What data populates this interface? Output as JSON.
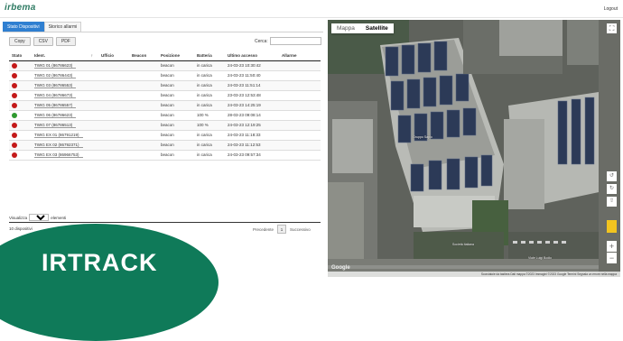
{
  "header": {
    "logo": "irbema",
    "logout": "Logout"
  },
  "tabs": [
    {
      "label": "Stato Dispositivi",
      "active": true
    },
    {
      "label": "Storico allarmi",
      "active": false
    }
  ],
  "toolbar": {
    "copy": "Copy",
    "csv": "CSV",
    "pdf": "PDF",
    "search_label": "Cerca:",
    "search_value": ""
  },
  "table": {
    "columns": [
      "Stato",
      "Ident.",
      "Ufficio",
      "Beacon",
      "Posizione",
      "Batteria",
      "Ultimo accesso",
      "Allarme"
    ],
    "rows": [
      {
        "status": "red",
        "ident": "TWIG 01 (86786623)",
        "ufficio": "",
        "beacon": "",
        "posizione": "beacon",
        "batteria": "in carica",
        "ultimo": "24-03-23 10:30:42",
        "allarme": ""
      },
      {
        "status": "red",
        "ident": "TWIG 02 (86786443)",
        "ufficio": "",
        "beacon": "",
        "posizione": "beacon",
        "batteria": "in carica",
        "ultimo": "24-03-23 11:50:40",
        "allarme": ""
      },
      {
        "status": "red",
        "ident": "TWIG 03 (86786553)",
        "ufficio": "",
        "beacon": "",
        "posizione": "beacon",
        "batteria": "in carica",
        "ultimo": "24-03-23 11:51:14",
        "allarme": ""
      },
      {
        "status": "red",
        "ident": "TWIG 04 (86786673)",
        "ufficio": "",
        "beacon": "",
        "posizione": "beacon",
        "batteria": "in carica",
        "ultimo": "23-03-23 12:53:48",
        "allarme": ""
      },
      {
        "status": "red",
        "ident": "TWIG 05 (86786557)",
        "ufficio": "",
        "beacon": "",
        "posizione": "beacon",
        "batteria": "in carica",
        "ultimo": "24-03-23 14:25:19",
        "allarme": ""
      },
      {
        "status": "green",
        "ident": "TWIG 06 (86786623)",
        "ufficio": "",
        "beacon": "",
        "posizione": "beacon",
        "batteria": "100 %",
        "ultimo": "28-03-23 09:08:14",
        "allarme": ""
      },
      {
        "status": "red",
        "ident": "TWIG 07 (86786513)",
        "ufficio": "",
        "beacon": "",
        "posizione": "beacon",
        "batteria": "100 %",
        "ultimo": "24-03-23 12:19:25",
        "allarme": ""
      },
      {
        "status": "red",
        "ident": "TWIG EX 01 (86791219)",
        "ufficio": "",
        "beacon": "",
        "posizione": "beacon",
        "batteria": "in carica",
        "ultimo": "24-03-23 11:18:33",
        "allarme": ""
      },
      {
        "status": "red",
        "ident": "TWIG EX 02 (86792371)",
        "ufficio": "",
        "beacon": "",
        "posizione": "beacon",
        "batteria": "in carica",
        "ultimo": "24-03-23 11:12:53",
        "allarme": ""
      },
      {
        "status": "red",
        "ident": "TWIG EX 03 (86966753)",
        "ufficio": "",
        "beacon": "",
        "posizione": "beacon",
        "batteria": "in carica",
        "ultimo": "24-03-23 09:57:34",
        "allarme": ""
      }
    ]
  },
  "pagination": {
    "show_label": "Visualizza",
    "show_value": "10",
    "show_suffix": "elementi",
    "info": "10 dispositivi",
    "prev": "Precedente",
    "page": "1",
    "next": "Successivo"
  },
  "map": {
    "tab_map": "Mappa",
    "tab_satellite": "Satellite",
    "active_tab": "Satellite",
    "label_building": "Gruppo Sapio",
    "label_road": "Viale Luigi Bodio",
    "label_fuel": "Società Italiana",
    "google": "Google",
    "footer": "Scorciatoie da tastiera   Dati mappa ©2023 Immagini ©2023 Google   Termini   Segnala un errore nella mappa"
  },
  "badge": {
    "text": "IRTRACK"
  },
  "colors": {
    "brand": "#0f7a59",
    "tab_active": "#2f7fd1",
    "status_red": "#c41a1a",
    "status_green": "#2e9a2e"
  }
}
